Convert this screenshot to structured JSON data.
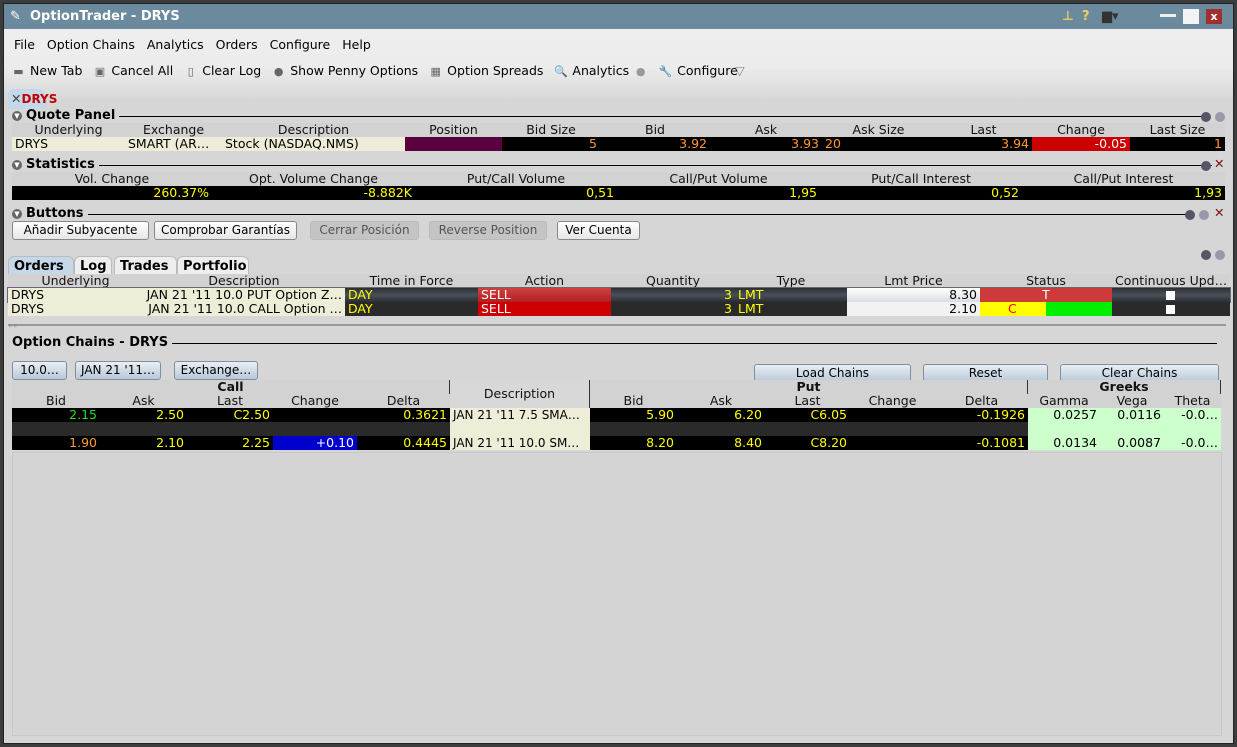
{
  "window": {
    "title": "OptionTrader - DRYS"
  },
  "menu": [
    "File",
    "Option Chains",
    "Analytics",
    "Orders",
    "Configure",
    "Help"
  ],
  "toolbar": [
    {
      "label": "New Tab",
      "icon": "new-tab-icon"
    },
    {
      "label": "Cancel All",
      "icon": "cancel-all-icon"
    },
    {
      "label": "Clear Log",
      "icon": "clear-log-icon"
    },
    {
      "label": "Show Penny Options",
      "icon": "penny-icon"
    },
    {
      "label": "Option Spreads",
      "icon": "spreads-chart-icon"
    },
    {
      "label": "Analytics",
      "icon": "magnifier-icon"
    },
    {
      "label": "Configure",
      "icon": "wrench-icon"
    }
  ],
  "page_tab": "DRYS",
  "quote_panel": {
    "title": "Quote Panel",
    "headers": [
      "Underlying",
      "Exchange",
      "Description",
      "Position",
      "Bid Size",
      "Bid",
      "Ask",
      "Ask Size",
      "Last",
      "Change",
      "Last Size"
    ],
    "values": [
      "DRYS",
      "SMART (AR…",
      "Stock (NASDAQ.NMS)",
      "",
      "5",
      "3.92",
      "3.93",
      "20",
      "3.94",
      "-0.05",
      "1"
    ]
  },
  "statistics": {
    "title": "Statistics",
    "headers": [
      "Vol. Change",
      "Opt. Volume Change",
      "Put/Call Volume",
      "Call/Put Volume",
      "Put/Call Interest",
      "Call/Put Interest"
    ],
    "values": [
      "260.37%",
      "-8.882K",
      "0,51",
      "1,95",
      "0,52",
      "1,93"
    ]
  },
  "buttons": {
    "title": "Buttons",
    "items": [
      "Añadir Subyacente",
      "Comprobar Garantías",
      "Cerrar Posición",
      "Reverse Position",
      "Ver Cuenta"
    ]
  },
  "bottom_tabs": [
    "Orders",
    "Log",
    "Trades",
    "Portfolio"
  ],
  "orders": {
    "headers": [
      "Underlying",
      "Description",
      "Time in Force",
      "Action",
      "Quantity",
      "Type",
      "Lmt Price",
      "Status",
      "Continuous Upd…"
    ],
    "rows": [
      [
        "DRYS",
        "JAN 21 '11 10.0 PUT Option Z…",
        "DAY",
        "SELL",
        "3",
        "LMT",
        "8.30",
        "T",
        ""
      ],
      [
        "DRYS",
        "JAN 21 '11 10.0 CALL Option …",
        "DAY",
        "SELL",
        "3",
        "LMT",
        "2.10",
        "C",
        ""
      ]
    ]
  },
  "chains": {
    "title": "Option Chains - DRYS",
    "selectors": [
      "10.0…",
      "JAN 21 '11…",
      "Exchange…"
    ],
    "actions": [
      "Load Chains",
      "Reset",
      "Clear Chains"
    ],
    "groups": [
      "Call",
      "Description",
      "Put",
      "Greeks"
    ],
    "call_headers": [
      "Bid",
      "Ask",
      "Last",
      "Change",
      "Delta"
    ],
    "put_headers": [
      "Bid",
      "Ask",
      "Last",
      "Change",
      "Delta"
    ],
    "greek_headers": [
      "Gamma",
      "Vega",
      "Theta"
    ],
    "rows": [
      {
        "call": [
          "2.15",
          "2.50",
          "C2.50",
          "",
          "0.3621"
        ],
        "desc": "JAN 21 '11 7.5 SMA…",
        "put": [
          "5.90",
          "6.20",
          "C6.05",
          "",
          "-0.1926"
        ],
        "greeks": [
          "0.0257",
          "0.0116",
          "-0.0…"
        ]
      },
      {
        "call": [
          "",
          "",
          "",
          "",
          ""
        ],
        "desc": "",
        "put": [
          "",
          "",
          "",
          "",
          ""
        ],
        "greeks": [
          "",
          "",
          ""
        ]
      },
      {
        "call": [
          "1.90",
          "2.10",
          "2.25",
          "+0.10",
          "0.4445"
        ],
        "desc": "JAN 21 '11 10.0 SM…",
        "put": [
          "8.20",
          "8.40",
          "C8.20",
          "",
          "-0.1081"
        ],
        "greeks": [
          "0.0134",
          "0.0087",
          "-0.0…"
        ]
      }
    ]
  },
  "colors": {
    "titlebar": "#6b8a9d",
    "yellow": "#ffff00",
    "orange": "#ff9933",
    "sell": "#cc0000",
    "green": "#00ff00",
    "greeks_bg": "#ccffcc"
  }
}
